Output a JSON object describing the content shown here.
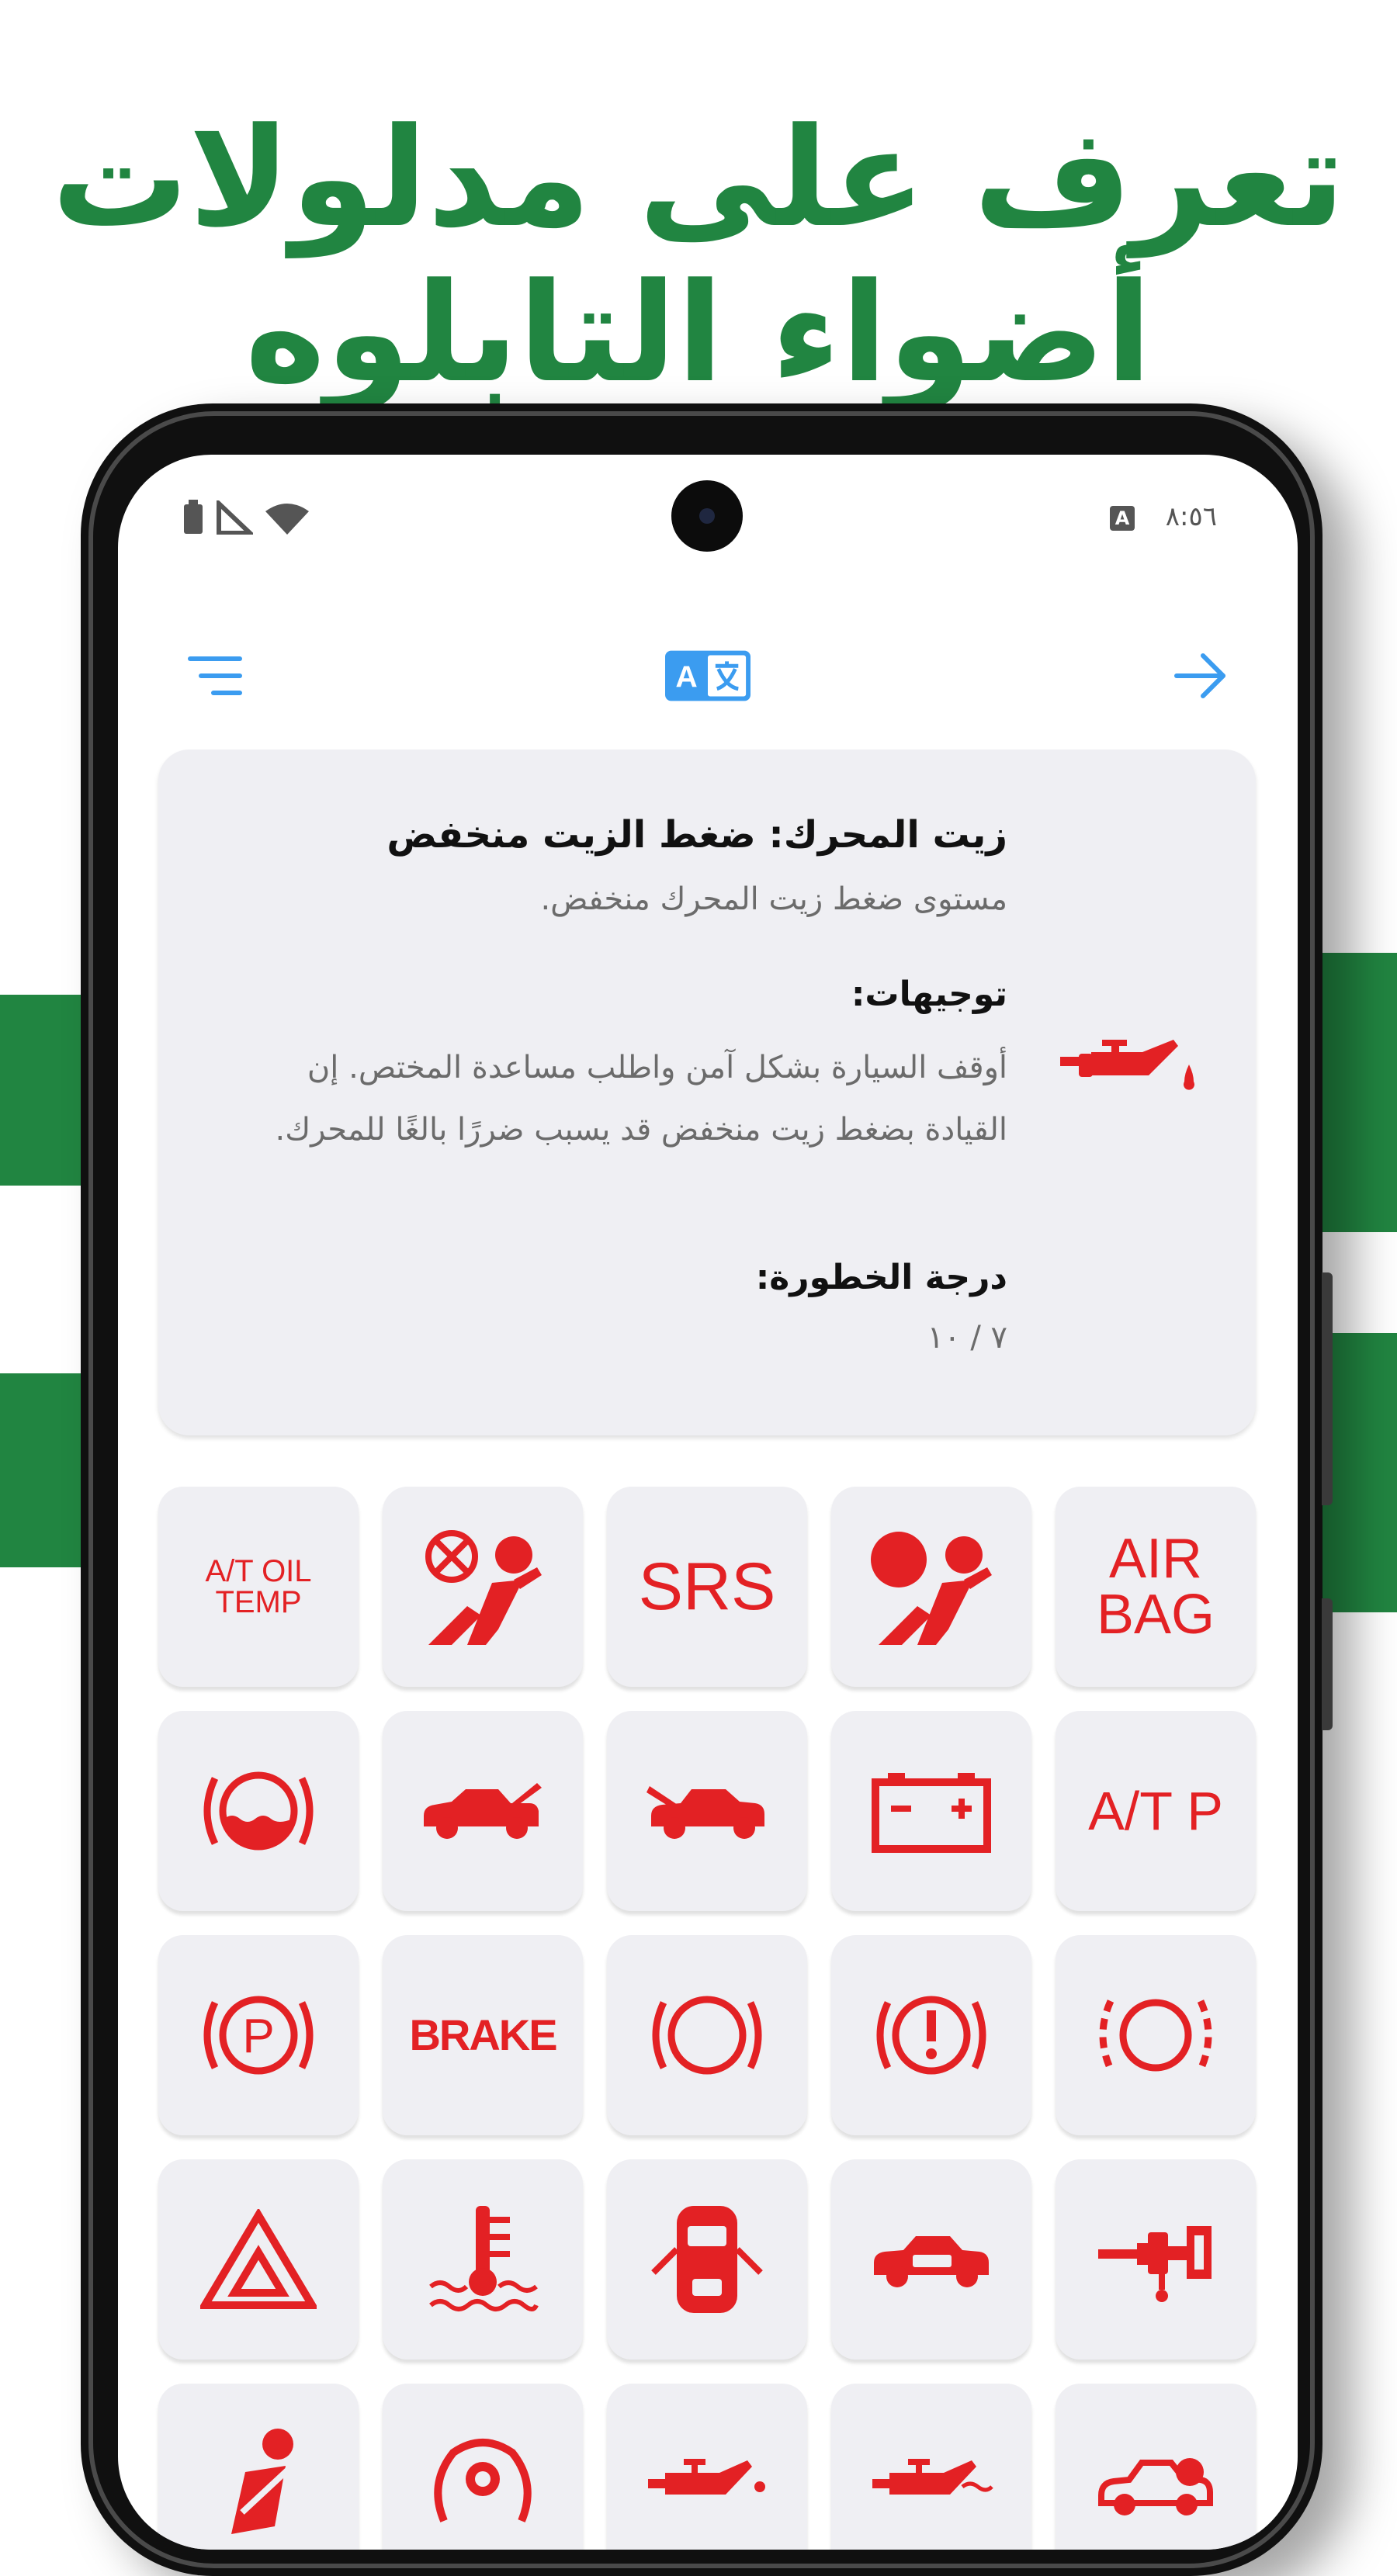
{
  "headline": {
    "line1": "تعرف على مدلولات",
    "line2": "أضواء التابلوه"
  },
  "status_bar": {
    "time": "٨:٥٦",
    "a_badge": "A"
  },
  "toolbar": {
    "translate_icon_label": "A"
  },
  "detail": {
    "title": "زيت المحرك: ضغط الزيت منخفض",
    "description": "مستوى ضغط زيت المحرك منخفض.",
    "guidance_title": "توجيهات:",
    "guidance_text": "أوقف السيارة بشكل آمن واطلب مساعدة المختص. إن القيادة بضغط زيت منخفض قد يسبب ضررًا بالغًا للمحرك.",
    "severity_title": "درجة الخطورة:",
    "severity_value": "٧ / ١٠",
    "icon": "oil-pressure-icon"
  },
  "warning_lights": {
    "text_tiles": {
      "at_oil_temp_line1": "A/T OIL",
      "at_oil_temp_line2": "TEMP",
      "srs": "SRS",
      "airbag_line1": "AIR",
      "airbag_line2": "BAG",
      "atp": "A/T P",
      "brake": "BRAKE"
    },
    "icons": [
      "at-oil-temp",
      "airbag-off-icon",
      "srs",
      "airbag-icon",
      "airbag-text",
      "brake-fluid-icon",
      "trunk-open-icon",
      "hood-open-icon",
      "battery-icon",
      "atp",
      "parking-brake-icon",
      "brake-text",
      "brake-circle-icon",
      "brake-warning-icon",
      "brake-wear-icon",
      "hazard-triangle-icon",
      "coolant-temp-icon",
      "door-open-icon",
      "engine-car-icon",
      "fuel-filter-icon",
      "seatbelt-icon",
      "tire-pressure-icon",
      "oil-can-icon",
      "oil-can-icon-2",
      "car-icon"
    ]
  },
  "colors": {
    "brand_green": "#218541",
    "warning_red": "#e32124",
    "accent_blue": "#3b9cf0",
    "card_bg": "#efeff3"
  }
}
